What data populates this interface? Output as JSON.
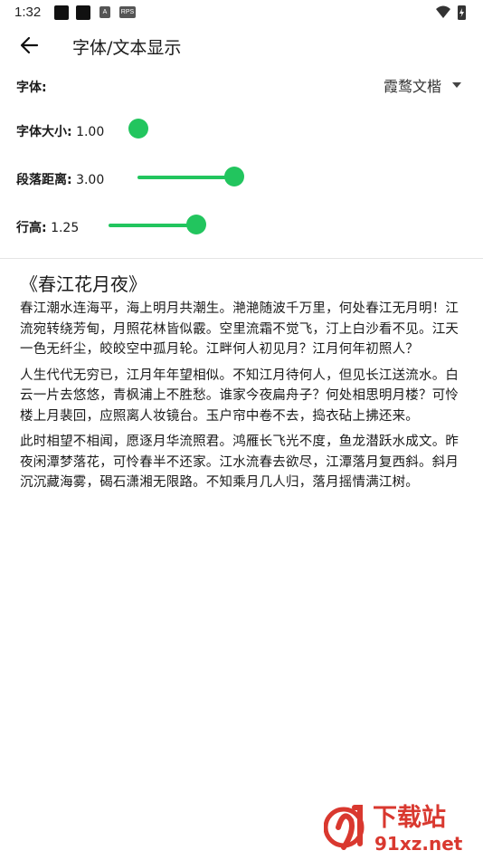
{
  "status_bar": {
    "time": "1:32",
    "icon_a_label": "A",
    "icon_rps_label": "RPS"
  },
  "app_bar": {
    "title": "字体/文本显示"
  },
  "settings": {
    "font": {
      "label": "字体:",
      "value": "霞鹜文楷"
    },
    "font_size": {
      "label": "字体大小:",
      "value": "1.00",
      "level": 0.0
    },
    "paragraph_spacing": {
      "label": "段落距离:",
      "value": "3.00",
      "level": 1.0
    },
    "line_height": {
      "label": "行高:",
      "value": "1.25",
      "level": 1.0
    }
  },
  "preview": {
    "title": "《春江花月夜》",
    "paragraphs": [
      "春江潮水连海平，海上明月共潮生。滟滟随波千万里，何处春江无月明！江流宛转绕芳甸，月照花林皆似霰。空里流霜不觉飞，汀上白沙看不见。江天一色无纤尘，皎皎空中孤月轮。江畔何人初见月？江月何年初照人？",
      "人生代代无穷已，江月年年望相似。不知江月待何人，但见长江送流水。白云一片去悠悠，青枫浦上不胜愁。谁家今夜扁舟子？何处相思明月楼？可怜楼上月裴回，应照离人妆镜台。玉户帘中卷不去，捣衣砧上拂还来。",
      "此时相望不相闻，愿逐月华流照君。鸿雁长飞光不度，鱼龙潜跃水成文。昨夜闲潭梦落花，可怜春半不还家。江水流春去欲尽，江潭落月复西斜。斜月沉沉藏海雾，碣石潇湘无限路。不知乘月几人归，落月摇情满江树。"
    ]
  },
  "watermark": {
    "brand_text": "下载站",
    "url_text": "91xz.net"
  },
  "colors": {
    "accent": "#22c55e",
    "watermark_red": "#d9382f"
  }
}
